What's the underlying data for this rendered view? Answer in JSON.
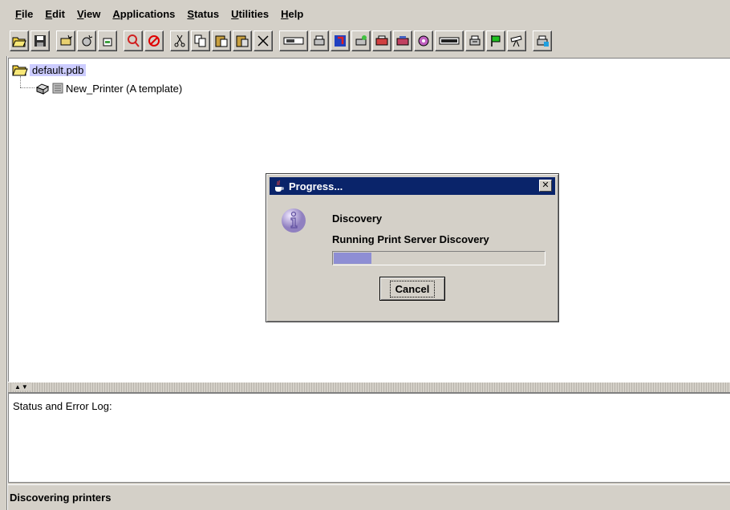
{
  "menubar": {
    "items": [
      {
        "label": "File",
        "mnemonic": "F",
        "rest": "ile"
      },
      {
        "label": "Edit",
        "mnemonic": "E",
        "rest": "dit"
      },
      {
        "label": "View",
        "mnemonic": "V",
        "rest": "iew"
      },
      {
        "label": "Applications",
        "mnemonic": "A",
        "rest": "pplications"
      },
      {
        "label": "Status",
        "mnemonic": "S",
        "rest": "tatus"
      },
      {
        "label": "Utilities",
        "mnemonic": "U",
        "rest": "tilities"
      },
      {
        "label": "Help",
        "mnemonic": "H",
        "rest": "elp"
      }
    ]
  },
  "toolbar": {
    "icons": [
      "open-folder-icon",
      "save-icon",
      "new-printer-icon",
      "new-port-icon",
      "new-queue-icon",
      "discover-icon",
      "stop-icon",
      "cut-icon",
      "copy-icon",
      "paste-icon",
      "paste-special-icon",
      "delete-icon",
      "printer-port-icon",
      "printer-config-icon",
      "network-icon",
      "printer-status-icon",
      "printer-error-icon",
      "printer-alert-icon",
      "printer-color-icon",
      "print-server-icon",
      "printer-settings-icon",
      "flag-icon",
      "telescope-icon",
      "printer-add-icon"
    ]
  },
  "tree": {
    "root_label": "default.pdb",
    "child_label": "New_Printer (A template)"
  },
  "log": {
    "label": "Status and Error Log:"
  },
  "statusbar": {
    "text": "Discovering printers"
  },
  "dialog": {
    "title": "Progress...",
    "close_label": "✕",
    "heading": "Discovery",
    "message": "Running Print Server Discovery",
    "progress": 0.18,
    "cancel_label": "Cancel"
  },
  "colors": {
    "window_bg": "#d4d0c8",
    "titlebar": "#0a246a",
    "selection": "#ccccff",
    "progress_fill": "#8e8ed4"
  }
}
